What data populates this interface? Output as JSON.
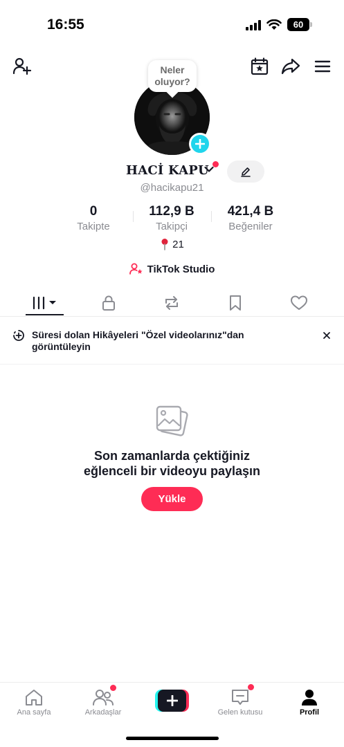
{
  "status_bar": {
    "time": "16:55",
    "battery": "60"
  },
  "top_nav": {
    "add_friend_icon": "person-plus-icon",
    "calendar_icon": "calendar-star-icon",
    "share_icon": "share-arrow-icon",
    "menu_icon": "hamburger-menu-icon"
  },
  "profile": {
    "tooltip": "Neler oluyor?",
    "name": "HACİ KAPU",
    "username": "@hacikapu21",
    "stats": [
      {
        "value": "0",
        "label": "Takipte"
      },
      {
        "value": "112,9 B",
        "label": "Takipçi"
      },
      {
        "value": "421,4 B",
        "label": "Beğeniler"
      }
    ],
    "location": "21",
    "studio_label": "TikTok Studio"
  },
  "tabs": [
    {
      "name": "videos",
      "icon": "grid-icon"
    },
    {
      "name": "private",
      "icon": "lock-icon"
    },
    {
      "name": "reposts",
      "icon": "repost-icon"
    },
    {
      "name": "saved",
      "icon": "bookmark-icon"
    },
    {
      "name": "liked",
      "icon": "heart-icon"
    }
  ],
  "banner": {
    "text": "Süresi dolan Hikâyeleri \"Özel videolarınız\"dan görüntüleyin"
  },
  "empty_state": {
    "title_line1": "Son zamanlarda çektiğiniz",
    "title_line2": "eğlenceli bir videoyu paylaşın",
    "upload_label": "Yükle"
  },
  "bottom_nav": [
    {
      "label": "Ana sayfa",
      "icon": "home-icon"
    },
    {
      "label": "Arkadaşlar",
      "icon": "friends-icon"
    },
    {
      "label": "",
      "icon": "plus-icon"
    },
    {
      "label": "Gelen kutusu",
      "icon": "inbox-icon"
    },
    {
      "label": "Profil",
      "icon": "profile-icon"
    }
  ],
  "colors": {
    "accent": "#fe2c55",
    "cyan": "#25f4ee",
    "story_plus": "#20d5ec"
  }
}
